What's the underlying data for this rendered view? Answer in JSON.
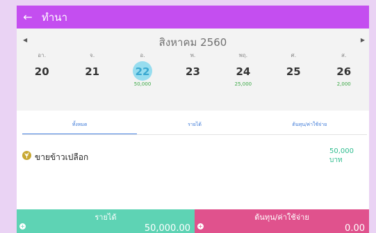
{
  "header": {
    "back_icon": "arrow-left-icon",
    "title": "ทำนา"
  },
  "calendar": {
    "month": "สิงหาคม 2560",
    "weekdays": [
      "อา.",
      "จ.",
      "อ.",
      "พ.",
      "พฤ.",
      "ศ.",
      "ส."
    ],
    "dates": [
      "20",
      "21",
      "22",
      "23",
      "24",
      "25",
      "26"
    ],
    "amounts": [
      "",
      "",
      "50,000",
      "",
      "25,000",
      "",
      "2,000"
    ],
    "selected_date": "22"
  },
  "tabs": [
    {
      "label": "ทั้งหมด",
      "active": true
    },
    {
      "label": "รายได้",
      "active": false
    },
    {
      "label": "ต้นทุน/ค่าใช้จ่าย",
      "active": false
    }
  ],
  "entries": [
    {
      "icon": "rice-icon",
      "name": "ขายข้าวเปลือก",
      "amount": "50,000",
      "unit": "บาท"
    }
  ],
  "footer": {
    "income_label": "รายได้",
    "income_value": "50,000.00",
    "expense_label": "ต้นทุน/ค่าใช้จ่าย",
    "expense_value": "0.00"
  },
  "colors": {
    "app_bar": "#c44ef0",
    "income": "#5ed3b4",
    "expense": "#e0528d",
    "tab_active": "#4a84e2",
    "selected_day": "#97ddef"
  }
}
